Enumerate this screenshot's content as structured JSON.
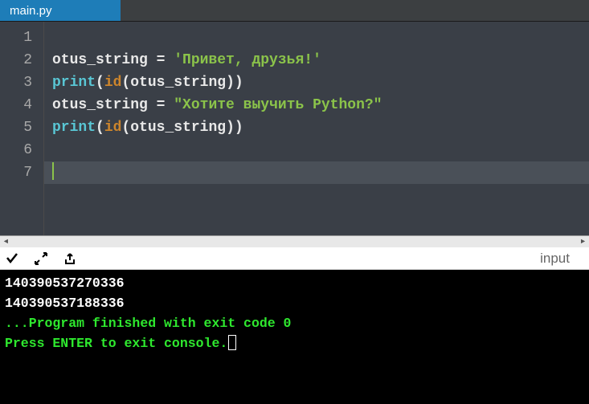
{
  "tab": {
    "filename": "main.py"
  },
  "gutter": {
    "lines": [
      "1",
      "2",
      "3",
      "4",
      "5",
      "6",
      "7"
    ]
  },
  "code": {
    "l2": {
      "var": "otus_string",
      "op": " = ",
      "str": "'Привет, друзья!'"
    },
    "l3": {
      "fn": "print",
      "open": "(",
      "builtin": "id",
      "open2": "(",
      "arg": "otus_string",
      "close": "))"
    },
    "l4": {
      "var": "otus_string",
      "op": " = ",
      "str": "\"Хотите выучить Python?\""
    },
    "l5": {
      "fn": "print",
      "open": "(",
      "builtin": "id",
      "open2": "(",
      "arg": "otus_string",
      "close": "))"
    }
  },
  "toolbar": {
    "input_label": "input"
  },
  "console": {
    "out1": "140390537270336",
    "out2": "140390537188336",
    "blank": "",
    "blank2": "",
    "exit": "...Program finished with exit code 0",
    "prompt": "Press ENTER to exit console."
  }
}
